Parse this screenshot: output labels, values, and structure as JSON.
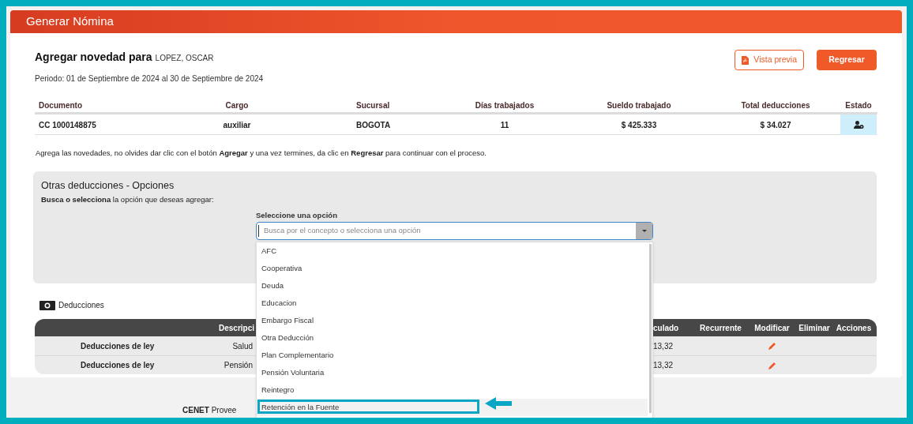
{
  "header": {
    "title": "Generar Nómina"
  },
  "employee": {
    "heading": "Agregar novedad para",
    "name": "LOPEZ, OSCAR",
    "period": "Periodo: 01 de Septiembre de 2024 al 30 de Septiembre de 2024"
  },
  "buttons": [
    {
      "label": "Vista previa",
      "kind": "outline"
    },
    {
      "label": "Regresar",
      "kind": "primary"
    }
  ],
  "summary": {
    "columns": [
      "Documento",
      "Cargo",
      "Sucursal",
      "Días trabajados",
      "Sueldo trabajado",
      "Total deducciones",
      "Estado"
    ],
    "row": [
      "CC 1000148875",
      "auxiliar",
      "BOGOTA",
      "11",
      "$ 425.333",
      "$ 34.027"
    ]
  },
  "instructions": "Agrega las novedades, no olvides dar clic con el botón **Agregar** y una vez termines, da clic en **Regresar** para continuar con el proceso.",
  "options_panel": {
    "title": "Otras deducciones - Opciones",
    "subtitle": "**Busca o selecciona** la opción que deseas agregar:",
    "select_label": "Seleccione una opción",
    "placeholder": "Busca por el concepto o selecciona una opción",
    "options": [
      {
        "label": "AFC",
        "selected": false
      },
      {
        "label": "Cooperativa",
        "selected": false
      },
      {
        "label": "Deuda",
        "selected": false
      },
      {
        "label": "Educacion",
        "selected": false
      },
      {
        "label": "Embargo Fiscal",
        "selected": false
      },
      {
        "label": "Otra Deducción",
        "selected": false
      },
      {
        "label": "Plan Complementario",
        "selected": false
      },
      {
        "label": "Pensión Voluntaria",
        "selected": false
      },
      {
        "label": "Reintegro",
        "selected": false
      },
      {
        "label": "Retención en la Fuente",
        "selected": true
      }
    ]
  },
  "deductions": {
    "title": "Deducciones",
    "columns": [
      "Descripci",
      "culado",
      "Recurrente",
      "Modificar",
      "Eliminar",
      "Acciones"
    ],
    "rows": [
      {
        "type": "Deducciones de ley",
        "description": "Salud",
        "value": "13,32"
      },
      {
        "type": "Deducciones de ley",
        "description": "Pensión",
        "value": "13,32"
      }
    ]
  },
  "footer": {
    "text": "**CENET** Provee"
  }
}
